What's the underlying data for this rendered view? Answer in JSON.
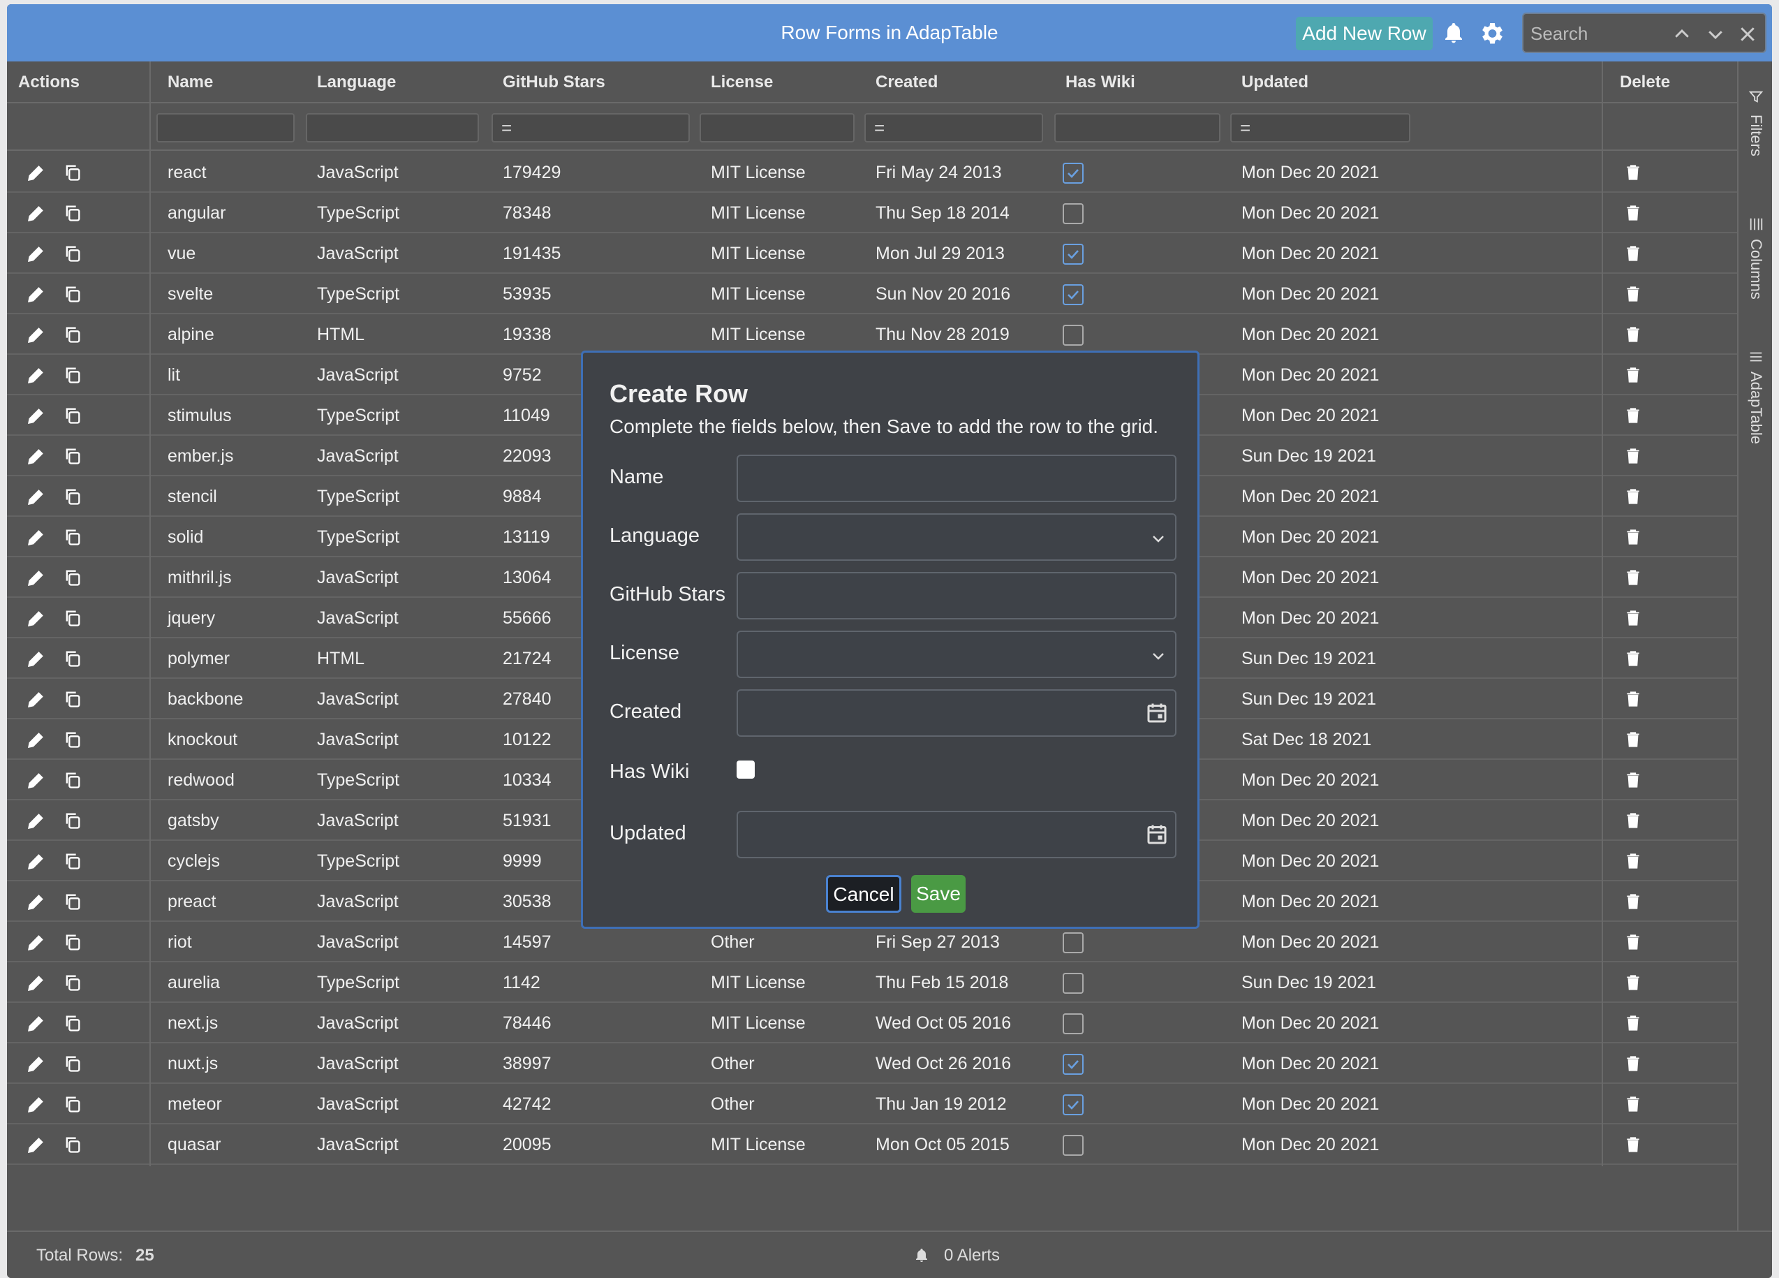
{
  "app": {
    "title": "Row Forms in AdapTable",
    "add_row_label": "Add New Row",
    "search_placeholder": "Search"
  },
  "columns": {
    "actions": "Actions",
    "name": "Name",
    "language": "Language",
    "stars": "GitHub Stars",
    "license": "License",
    "created": "Created",
    "wiki": "Has Wiki",
    "updated": "Updated",
    "delete": "Delete"
  },
  "filters": {
    "equals_symbol": "="
  },
  "rows": [
    {
      "name": "react",
      "language": "JavaScript",
      "stars": "179429",
      "license": "MIT License",
      "created": "Fri May 24 2013",
      "wiki": true,
      "updated": "Mon Dec 20 2021"
    },
    {
      "name": "angular",
      "language": "TypeScript",
      "stars": "78348",
      "license": "MIT License",
      "created": "Thu Sep 18 2014",
      "wiki": false,
      "updated": "Mon Dec 20 2021"
    },
    {
      "name": "vue",
      "language": "JavaScript",
      "stars": "191435",
      "license": "MIT License",
      "created": "Mon Jul 29 2013",
      "wiki": true,
      "updated": "Mon Dec 20 2021"
    },
    {
      "name": "svelte",
      "language": "TypeScript",
      "stars": "53935",
      "license": "MIT License",
      "created": "Sun Nov 20 2016",
      "wiki": true,
      "updated": "Mon Dec 20 2021"
    },
    {
      "name": "alpine",
      "language": "HTML",
      "stars": "19338",
      "license": "MIT License",
      "created": "Thu Nov 28 2019",
      "wiki": false,
      "updated": "Mon Dec 20 2021"
    },
    {
      "name": "lit",
      "language": "JavaScript",
      "stars": "9752",
      "license": "",
      "created": "",
      "wiki": null,
      "updated": "Mon Dec 20 2021"
    },
    {
      "name": "stimulus",
      "language": "TypeScript",
      "stars": "11049",
      "license": "",
      "created": "",
      "wiki": null,
      "updated": "Mon Dec 20 2021"
    },
    {
      "name": "ember.js",
      "language": "JavaScript",
      "stars": "22093",
      "license": "",
      "created": "",
      "wiki": null,
      "updated": "Sun Dec 19 2021"
    },
    {
      "name": "stencil",
      "language": "TypeScript",
      "stars": "9884",
      "license": "",
      "created": "",
      "wiki": null,
      "updated": "Mon Dec 20 2021"
    },
    {
      "name": "solid",
      "language": "TypeScript",
      "stars": "13119",
      "license": "",
      "created": "",
      "wiki": null,
      "updated": "Mon Dec 20 2021"
    },
    {
      "name": "mithril.js",
      "language": "JavaScript",
      "stars": "13064",
      "license": "",
      "created": "",
      "wiki": null,
      "updated": "Mon Dec 20 2021"
    },
    {
      "name": "jquery",
      "language": "JavaScript",
      "stars": "55666",
      "license": "",
      "created": "",
      "wiki": null,
      "updated": "Mon Dec 20 2021"
    },
    {
      "name": "polymer",
      "language": "HTML",
      "stars": "21724",
      "license": "",
      "created": "",
      "wiki": null,
      "updated": "Sun Dec 19 2021"
    },
    {
      "name": "backbone",
      "language": "JavaScript",
      "stars": "27840",
      "license": "",
      "created": "",
      "wiki": null,
      "updated": "Sun Dec 19 2021"
    },
    {
      "name": "knockout",
      "language": "JavaScript",
      "stars": "10122",
      "license": "",
      "created": "",
      "wiki": null,
      "updated": "Sat Dec 18 2021"
    },
    {
      "name": "redwood",
      "language": "TypeScript",
      "stars": "10334",
      "license": "",
      "created": "",
      "wiki": null,
      "updated": "Mon Dec 20 2021"
    },
    {
      "name": "gatsby",
      "language": "JavaScript",
      "stars": "51931",
      "license": "",
      "created": "",
      "wiki": null,
      "updated": "Mon Dec 20 2021"
    },
    {
      "name": "cyclejs",
      "language": "TypeScript",
      "stars": "9999",
      "license": "",
      "created": "",
      "wiki": null,
      "updated": "Mon Dec 20 2021"
    },
    {
      "name": "preact",
      "language": "JavaScript",
      "stars": "30538",
      "license": "",
      "created": "",
      "wiki": null,
      "updated": "Mon Dec 20 2021"
    },
    {
      "name": "riot",
      "language": "JavaScript",
      "stars": "14597",
      "license": "Other",
      "created": "Fri Sep 27 2013",
      "wiki": false,
      "updated": "Mon Dec 20 2021"
    },
    {
      "name": "aurelia",
      "language": "TypeScript",
      "stars": "1142",
      "license": "MIT License",
      "created": "Thu Feb 15 2018",
      "wiki": false,
      "updated": "Sun Dec 19 2021"
    },
    {
      "name": "next.js",
      "language": "JavaScript",
      "stars": "78446",
      "license": "MIT License",
      "created": "Wed Oct 05 2016",
      "wiki": false,
      "updated": "Mon Dec 20 2021"
    },
    {
      "name": "nuxt.js",
      "language": "JavaScript",
      "stars": "38997",
      "license": "Other",
      "created": "Wed Oct 26 2016",
      "wiki": true,
      "updated": "Mon Dec 20 2021"
    },
    {
      "name": "meteor",
      "language": "JavaScript",
      "stars": "42742",
      "license": "Other",
      "created": "Thu Jan 19 2012",
      "wiki": true,
      "updated": "Mon Dec 20 2021"
    },
    {
      "name": "quasar",
      "language": "JavaScript",
      "stars": "20095",
      "license": "MIT License",
      "created": "Mon Oct 05 2015",
      "wiki": false,
      "updated": "Mon Dec 20 2021"
    }
  ],
  "sidebar": {
    "filters": "Filters",
    "columns": "Columns",
    "adaptable": "AdapTable"
  },
  "status": {
    "total_rows_label": "Total Rows:",
    "total_rows_value": "25",
    "alerts": "0 Alerts"
  },
  "dialog": {
    "title": "Create Row",
    "description": "Complete the fields below, then Save to add the row to the grid.",
    "fields": {
      "name": "Name",
      "language": "Language",
      "stars": "GitHub Stars",
      "license": "License",
      "created": "Created",
      "wiki": "Has Wiki",
      "updated": "Updated"
    },
    "cancel": "Cancel",
    "save": "Save"
  },
  "colors": {
    "titlebar": "#5b8fd3",
    "add_button": "#4ea8b0",
    "save_button": "#4a9a44",
    "dialog_border": "#3e6fb6",
    "checkbox_checked": "#6aa0e0"
  }
}
